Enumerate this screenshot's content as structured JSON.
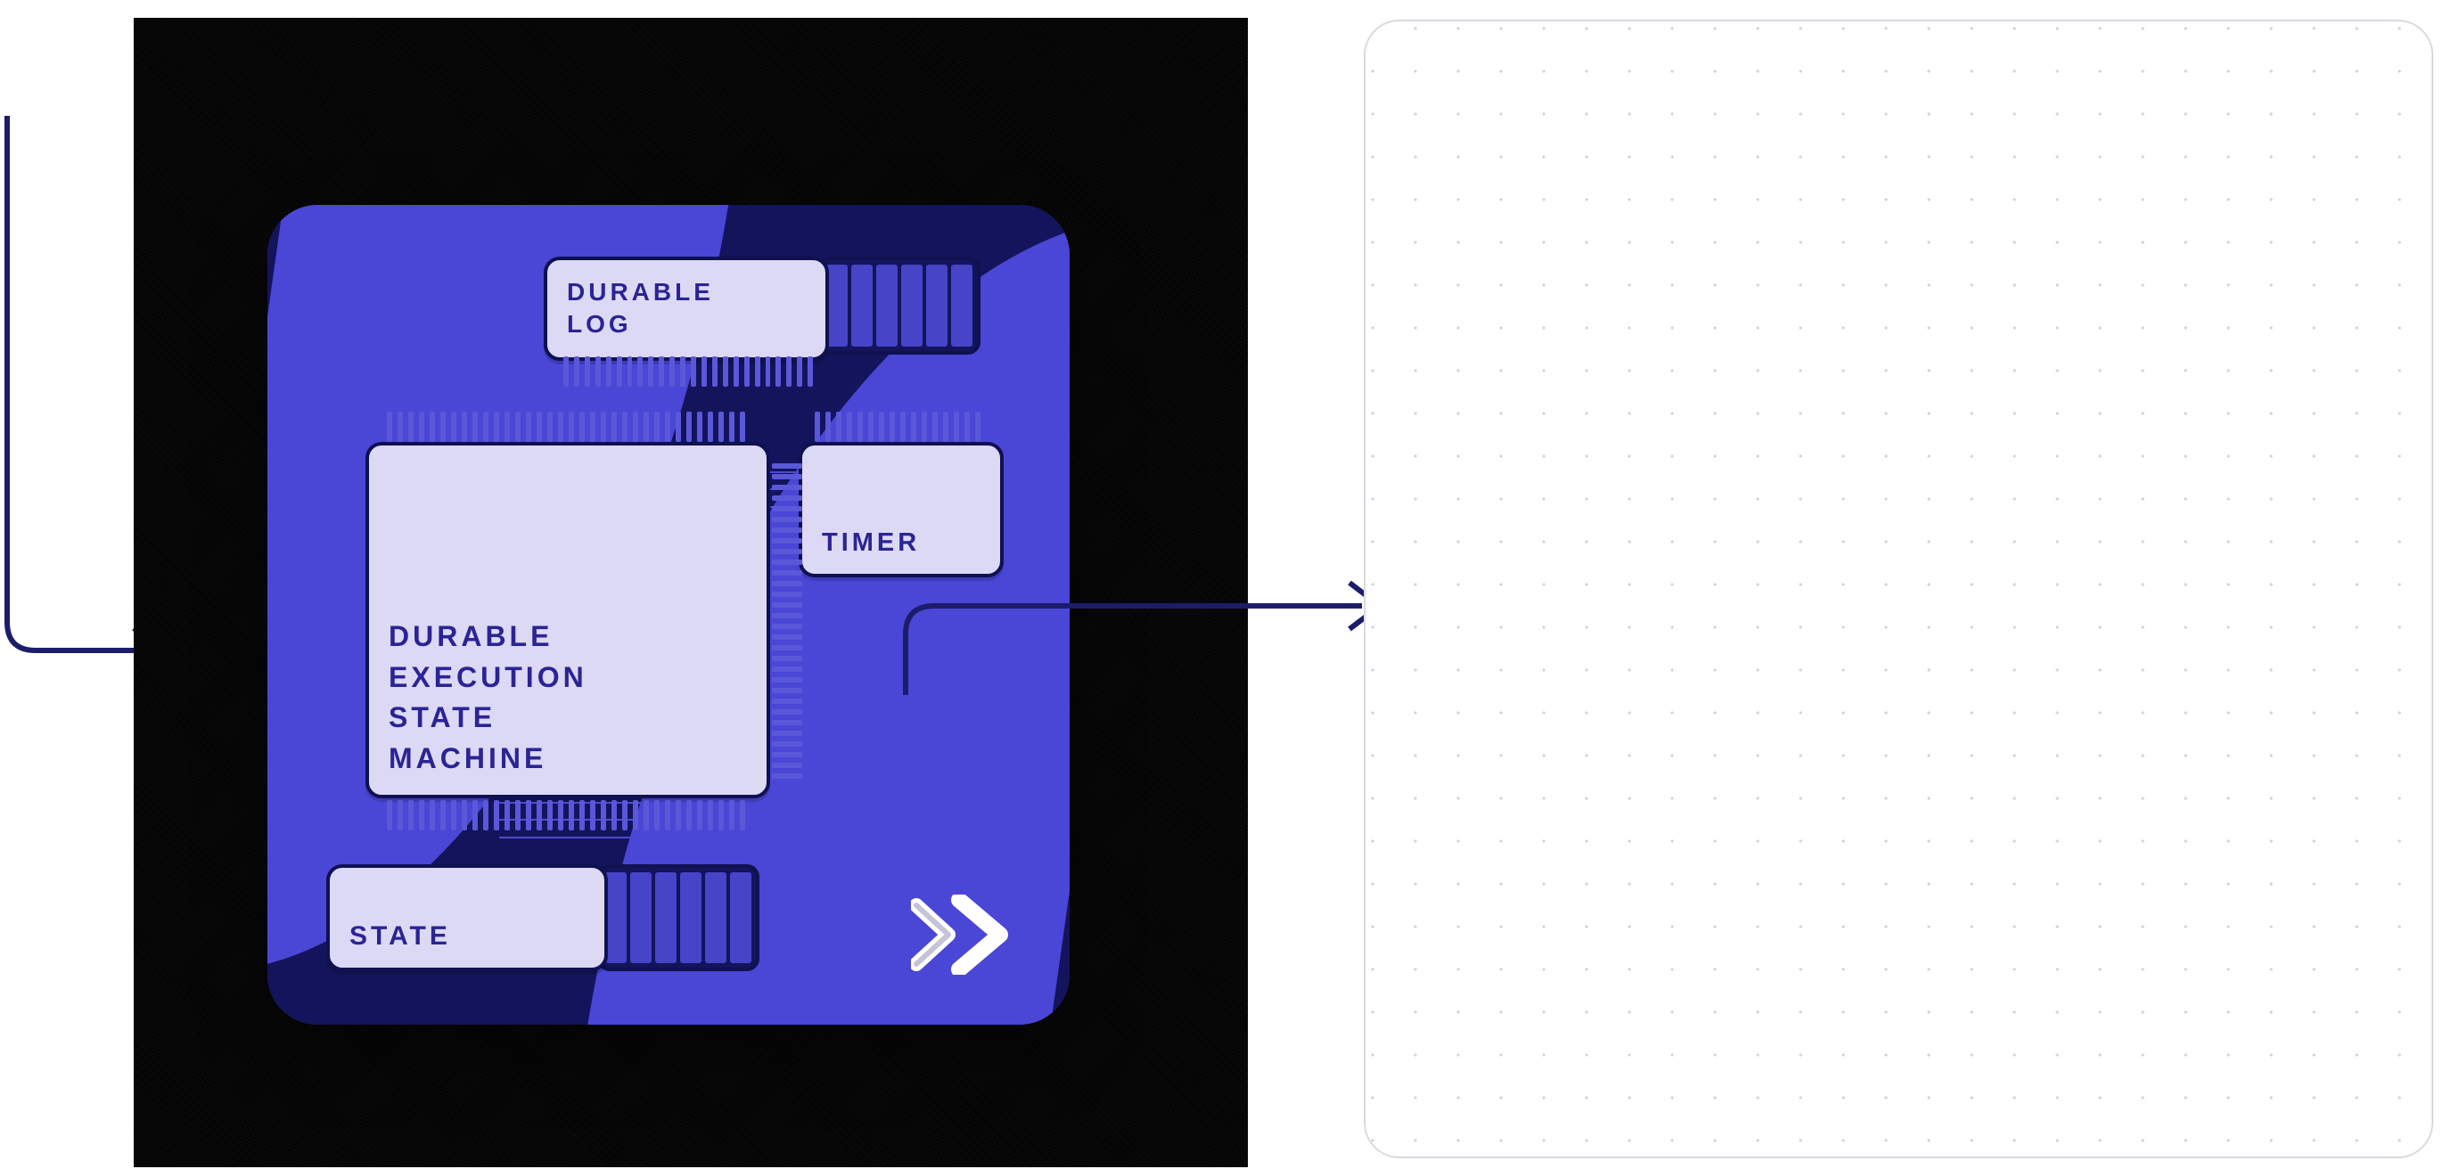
{
  "diagram": {
    "card": {
      "box_durable_log": {
        "line1": "DURABLE",
        "line2": "LOG"
      },
      "box_state_machine": {
        "line1": "DURABLE",
        "line2": "EXECUTION",
        "line3": "STATE",
        "line4": "MACHINE"
      },
      "box_timer": {
        "label": "TIMER"
      },
      "box_state": {
        "label": "STATE"
      }
    },
    "colors": {
      "card_bg": "#4a46d6",
      "card_dark": "#13145b",
      "chip_fill": "#dcd9f5",
      "chip_text": "#2b2494",
      "arrow": "#1c1d6a"
    }
  }
}
